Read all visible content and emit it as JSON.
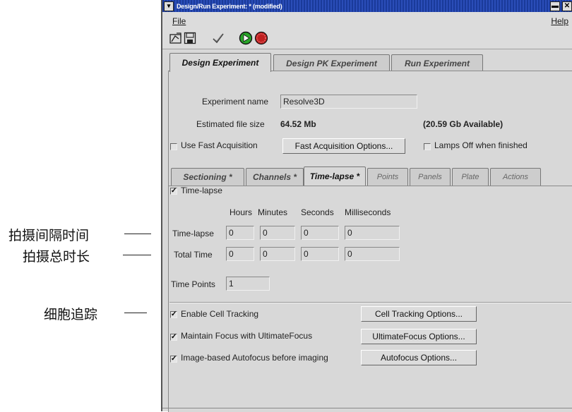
{
  "annotations": {
    "interval": "拍摄间隔时间",
    "total": "拍摄总时长",
    "tracking": "细胞追踪"
  },
  "window": {
    "title": "Design/Run Experiment: * (modified)",
    "menu_glyph": "▾",
    "minimize_glyph": "▬",
    "close_glyph": "✕"
  },
  "menubar": {
    "file": "File",
    "help": "Help"
  },
  "toolbar": {
    "icons": [
      "open-file-icon",
      "save-icon",
      "check-icon",
      "run-icon",
      "stop-icon"
    ],
    "run_color": "#2aa52a",
    "stop_color": "#c02020"
  },
  "main_tabs": [
    "Design Experiment",
    "Design PK Experiment",
    "Run Experiment"
  ],
  "experiment": {
    "name_label": "Experiment name",
    "name_value": "Resolve3D",
    "size_label": "Estimated file size",
    "size_value": "64.52 Mb",
    "available": "(20.59 Gb Available)",
    "fast_acq_label": "Use Fast Acquisition",
    "fast_acq_button": "Fast Acquisition Options...",
    "lamps_label": "Lamps Off when finished"
  },
  "sub_tabs": [
    "Sectioning *",
    "Channels *",
    "Time-lapse *",
    "Points",
    "Panels",
    "Plate",
    "Actions"
  ],
  "timelapse": {
    "enable_label": "Time-lapse",
    "checkmark": "✓",
    "columns": [
      "Hours",
      "Minutes",
      "Seconds",
      "Milliseconds"
    ],
    "rows": [
      {
        "label": "Time-lapse",
        "values": [
          "0",
          "0",
          "0",
          "0"
        ]
      },
      {
        "label": "Total Time",
        "values": [
          "0",
          "0",
          "0",
          "0"
        ]
      }
    ],
    "points_label": "Time Points",
    "points_value": "1"
  },
  "options": [
    {
      "label": "Enable Cell Tracking",
      "button": "Cell Tracking Options..."
    },
    {
      "label": "Maintain Focus with UltimateFocus",
      "button": "UltimateFocus Options..."
    },
    {
      "label": "Image-based Autofocus before imaging",
      "button": "Autofocus Options..."
    }
  ]
}
